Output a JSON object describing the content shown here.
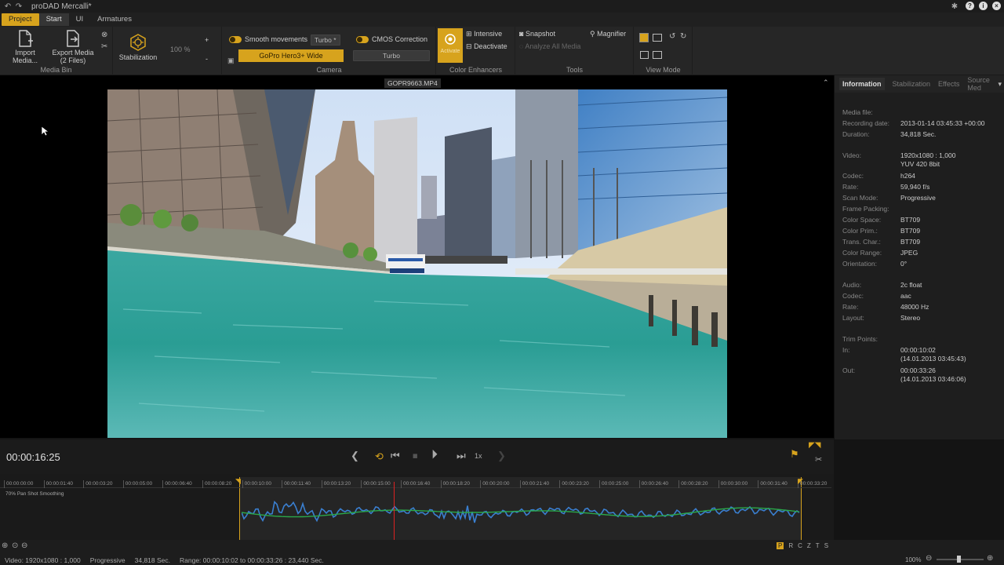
{
  "app": {
    "title": "proDAD Mercalli*"
  },
  "menu_tabs": [
    "Project",
    "Start",
    "UI",
    "Armatures"
  ],
  "ribbon": {
    "media_bin": {
      "label": "Media Bin",
      "import": "Import Media...",
      "export_line1": "Export Media",
      "export_line2": "(2 Files)"
    },
    "stabilization": {
      "label": "Stabilization",
      "zoom": "100 %",
      "plus": "+",
      "minus": "-"
    },
    "camera": {
      "label": "Camera",
      "smooth_label": "Smooth movements",
      "smooth_mode": "Turbo *",
      "camera_profile": "GoPro Hero3+ Wide",
      "cmos_label": "CMOS Correction",
      "cmos_mode": "Turbo"
    },
    "color": {
      "label": "Color Enhancers",
      "activate": "Activate",
      "intensive": "Intensive",
      "deactivate": "Deactivate"
    },
    "tools": {
      "label": "Tools",
      "snapshot": "Snapshot",
      "magnifier": "Magnifier",
      "analyze": "Analyze All Media"
    },
    "view_mode": {
      "label": "View Mode"
    }
  },
  "viewer": {
    "filename": "GOPR9663.MP4"
  },
  "info": {
    "tabs": [
      "Information",
      "Stabilization",
      "Effects",
      "Source Med"
    ],
    "rows": [
      {
        "k": "Media file:",
        "v": ""
      },
      {
        "k": "Recording date:",
        "v": "2013-01-14 03:45:33 +00:00"
      },
      {
        "k": "Duration:",
        "v": "34,818 Sec."
      },
      {
        "k": "Video:",
        "v": "1920x1080 : 1,000"
      },
      {
        "k": "",
        "v": "YUV 420 8bit"
      },
      {
        "k": "Codec:",
        "v": "h264"
      },
      {
        "k": "Rate:",
        "v": "59,940 f/s"
      },
      {
        "k": "Scan Mode:",
        "v": "Progressive"
      },
      {
        "k": "Frame Packing:",
        "v": ""
      },
      {
        "k": "Color Space:",
        "v": "BT709"
      },
      {
        "k": "Color Prim.:",
        "v": "BT709"
      },
      {
        "k": "Trans. Char.:",
        "v": "BT709"
      },
      {
        "k": "Color Range:",
        "v": "JPEG"
      },
      {
        "k": "Orientation:",
        "v": "0°"
      },
      {
        "k": "Audio:",
        "v": "2c float"
      },
      {
        "k": "Codec:",
        "v": "aac"
      },
      {
        "k": "Rate:",
        "v": "48000 Hz"
      },
      {
        "k": "Layout:",
        "v": "Stereo"
      },
      {
        "k": "Trim Points:",
        "v": ""
      },
      {
        "k": "In:",
        "v": "00:00:10:02"
      },
      {
        "k": "",
        "v": "(14.01.2013 03:45:43)"
      },
      {
        "k": "Out:",
        "v": "00:00:33:26"
      },
      {
        "k": "",
        "v": "(14.01.2013 03:46:06)"
      }
    ]
  },
  "transport": {
    "timecode": "00:00:16:25",
    "speed": "1x"
  },
  "timeline": {
    "ticks": [
      "00:00:00:00",
      "00:00:01:40",
      "00:00:03:20",
      "00:00:05:00",
      "00:00:06:40",
      "00:00:08:20",
      "00:00:10:00",
      "00:00:11:40",
      "00:00:13:20",
      "00:00:15:00",
      "00:00:16:40",
      "00:00:18:20",
      "00:00:20:00",
      "00:00:21:40",
      "00:00:23:20",
      "00:00:25:00",
      "00:00:26:40",
      "00:00:28:20",
      "00:00:30:00",
      "00:00:31:40",
      "00:00:33:20"
    ],
    "track_name": "70% Pan Shot Smoothing"
  },
  "status": {
    "video": "Video: 1920x1080 : 1,000",
    "scan": "Progressive",
    "duration": "34,818 Sec.",
    "range": "Range: 00:00:10:02 to 00:00:33:26 : 23,440 Sec.",
    "zoom": "100%"
  },
  "modes": [
    "P",
    "R",
    "C",
    "Z",
    "T",
    "S"
  ],
  "colors": {
    "accent": "#d7a31d",
    "waveform_blue": "#3a7fd0",
    "waveform_green": "#2aa84a",
    "playhead": "#dd2222"
  }
}
